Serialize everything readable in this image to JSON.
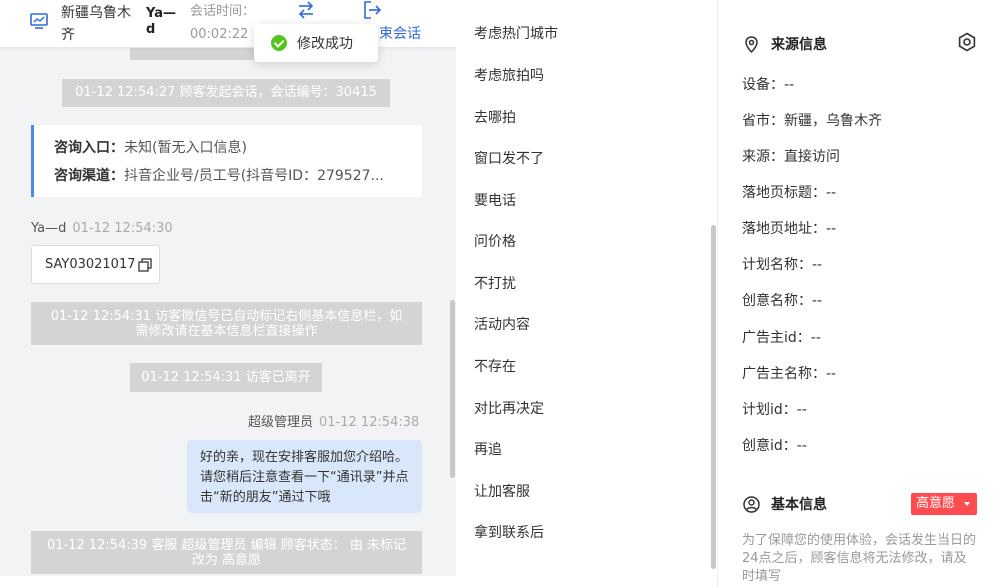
{
  "header": {
    "city": "新疆乌鲁木齐",
    "user": "Ya—d",
    "time_label": "会话时间：",
    "time_value": "00:02:22",
    "end_label": "束会话",
    "icons": [
      "monitor-icon",
      "transfer-icon",
      "exit-icon"
    ]
  },
  "toast": {
    "text": "修改成功",
    "icon": "check-circle-icon"
  },
  "chat": {
    "system_start": "01-12 12:54:27 顾客发起会话，会话编号：30415",
    "card": {
      "entry_key": "咨询入口：",
      "entry_value": "未知(暂无入口信息)",
      "channel_key": "咨询渠道：",
      "channel_value": "抖音企业号/员工号(抖音号ID：279527..."
    },
    "msg1": {
      "sender": "Ya—d",
      "time": "01-12 12:54:30",
      "text": "SAY03021017"
    },
    "system_wechat": "01-12 12:54:31 访客微信号已自动标记右侧基本信息栏，如需修改请在基本信息栏直接操作",
    "system_left": "01-12 12:54:31 访客已离开",
    "msg2": {
      "sender": "超级管理员",
      "time": "01-12 12:54:38",
      "text": "好的亲，现在安排客服加您介绍哈。请您稍后注意查看一下“通讯录”并点击“新的朋友”通过下哦"
    },
    "system_status": "01-12 12:54:39 客服 超级管理员 编辑 顾客状态： 由 未标记 改为 高意愿"
  },
  "quick_replies": [
    "考虑热门城市",
    "考虑旅拍吗",
    "去哪拍",
    "窗口发不了",
    "要电话",
    "问价格",
    "不打扰",
    "活动内容",
    "不存在",
    "对比再决定",
    "再追",
    "让加客服",
    "拿到联系后"
  ],
  "source_info": {
    "title": "来源信息",
    "rows": [
      "设备：--",
      "省市：新疆，乌鲁木齐",
      "来源：直接访问",
      "落地页标题：--",
      "落地页地址：--",
      "计划名称：--",
      "创意名称：--",
      "广告主id：--",
      "广告主名称：--",
      "计划id：--",
      "创意id：--"
    ]
  },
  "basic_info": {
    "title": "基本信息",
    "badge": "高意愿",
    "badge_color": "#ff4d4f",
    "note": "为了保障您的使用体验，会话发生当日的24点之后，顾客信息将无法修改，请及时填写"
  },
  "colors": {
    "accent": "#2f6bdf",
    "bubble": "#d9e7fb",
    "system": "#d4d4d4"
  }
}
